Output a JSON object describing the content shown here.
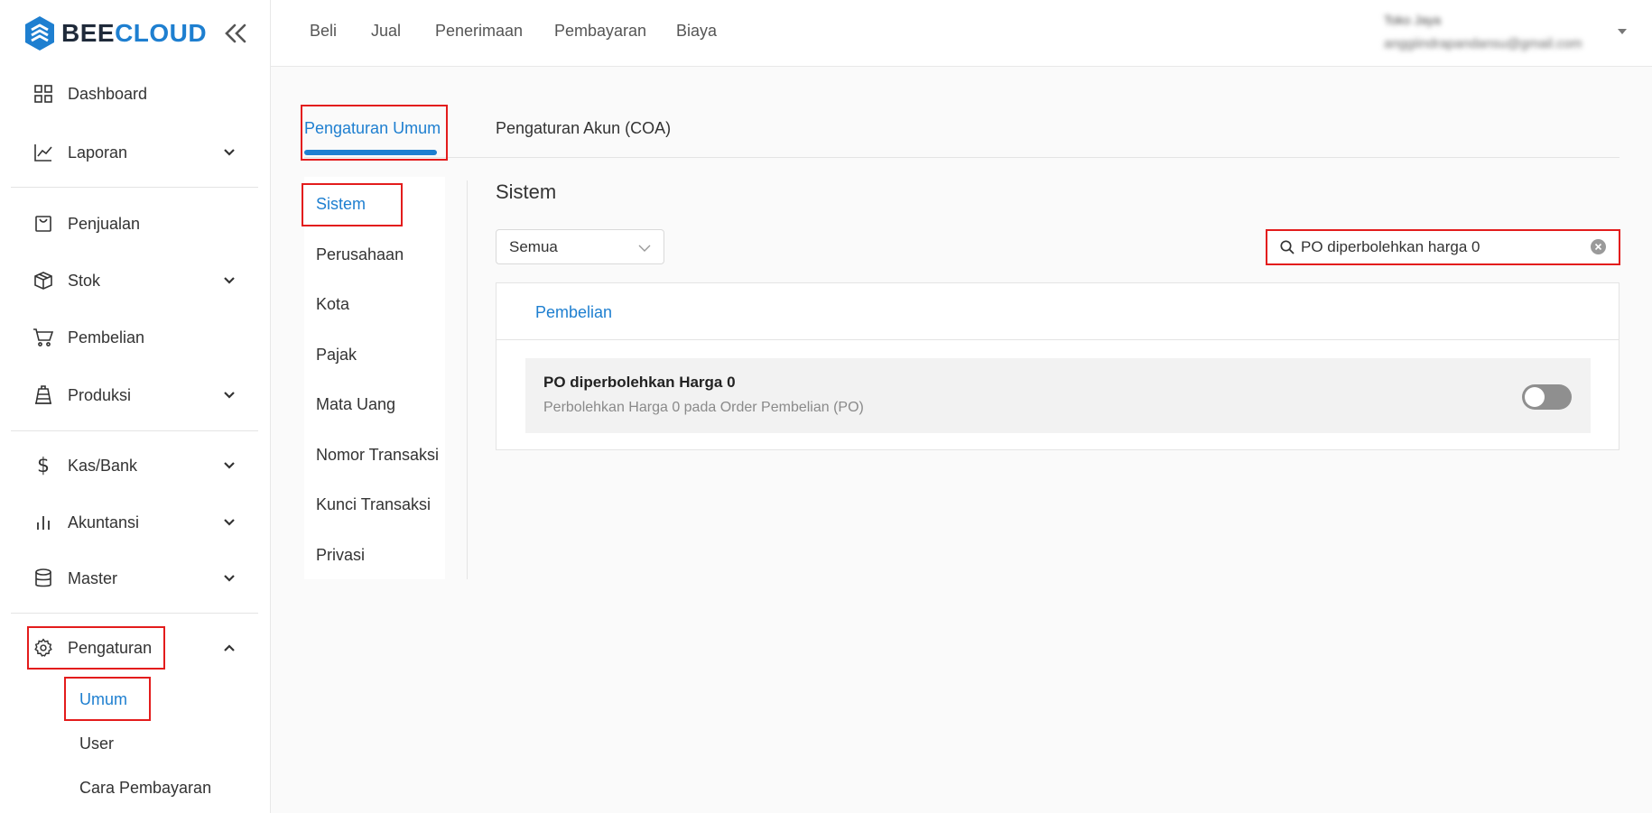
{
  "brand": {
    "part1": "BEE",
    "part2": "CLOUD"
  },
  "sidebar": {
    "items": [
      {
        "label": "Dashboard"
      },
      {
        "label": "Laporan"
      },
      {
        "label": "Penjualan"
      },
      {
        "label": "Stok"
      },
      {
        "label": "Pembelian"
      },
      {
        "label": "Produksi"
      },
      {
        "label": "Kas/Bank"
      },
      {
        "label": "Akuntansi"
      },
      {
        "label": "Master"
      },
      {
        "label": "Pengaturan"
      }
    ],
    "sub_items": [
      {
        "label": "Umum",
        "active": true
      },
      {
        "label": "User"
      },
      {
        "label": "Cara Pembayaran"
      }
    ]
  },
  "topbar": {
    "nav": [
      "Beli",
      "Jual",
      "Penerimaan",
      "Pembayaran",
      "Biaya"
    ],
    "user_name": "Toko Jaya",
    "user_email": "anggiindrapandansu@gmail.com"
  },
  "tabs": [
    "Pengaturan Umum",
    "Pengaturan Akun (COA)"
  ],
  "settings_menu": [
    "Sistem",
    "Perusahaan",
    "Kota",
    "Pajak",
    "Mata Uang",
    "Nomor Transaksi",
    "Kunci Transaksi",
    "Privasi"
  ],
  "content": {
    "section_title": "Sistem",
    "filter_value": "Semua",
    "search_value": "PO diperbolehkan harga 0",
    "panel_tab": "Pembelian",
    "setting": {
      "title": "PO diperbolehkan Harga 0",
      "description": "Perbolehkan Harga 0 pada Order Pembelian (PO)",
      "enabled": false
    }
  },
  "colors": {
    "accent": "#1e7fd0",
    "highlight": "#e31c1c"
  }
}
